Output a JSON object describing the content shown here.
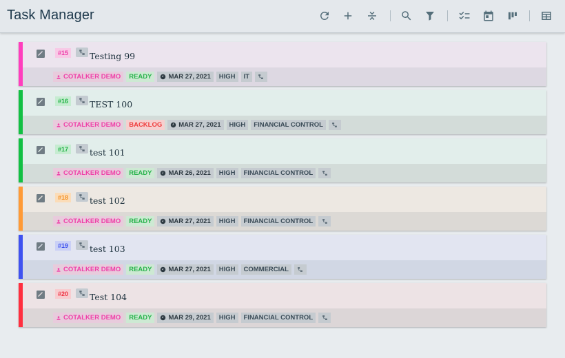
{
  "app": {
    "title": "Task Manager"
  },
  "toolbar": {
    "buttons": [
      {
        "name": "refresh-icon"
      },
      {
        "name": "add-icon"
      },
      {
        "name": "collapse-icon"
      },
      {
        "name": "search-icon"
      },
      {
        "name": "filter-icon"
      },
      {
        "name": "checklist-icon"
      },
      {
        "name": "calendar-icon"
      },
      {
        "name": "board-icon"
      },
      {
        "name": "table-icon"
      }
    ]
  },
  "tasks": [
    {
      "number": "#15",
      "title": "Testing 99",
      "user": "COTALKER DEMO",
      "status": "READY",
      "date": "MAR 27, 2021",
      "priority": "HIGH",
      "category": "IT",
      "accent": "#ff3ebd",
      "top_bg": "#ece4ee",
      "bottom_bg": "#ddd8e2",
      "num_bg": "#f8c9e6",
      "num_color": "#ee3aa8",
      "status_kind": "ready"
    },
    {
      "number": "#16",
      "title": "TEST 100",
      "user": "COTALKER DEMO",
      "status": "BACKLOG",
      "date": "MAR 27, 2021",
      "priority": "HIGH",
      "category": "FINANCIAL CONTROL",
      "accent": "#12c043",
      "top_bg": "#e2eeeb",
      "bottom_bg": "#d3dcd9",
      "num_bg": "#c6ecd1",
      "num_color": "#20b345",
      "status_kind": "backlog"
    },
    {
      "number": "#17",
      "title": "test 101",
      "user": "COTALKER DEMO",
      "status": "READY",
      "date": "MAR 26, 2021",
      "priority": "HIGH",
      "category": "FINANCIAL CONTROL",
      "accent": "#12c043",
      "top_bg": "#e2eeeb",
      "bottom_bg": "#d3dcd9",
      "num_bg": "#c6ecd1",
      "num_color": "#20b345",
      "status_kind": "ready"
    },
    {
      "number": "#18",
      "title": "test 102",
      "user": "COTALKER DEMO",
      "status": "READY",
      "date": "MAR 27, 2021",
      "priority": "HIGH",
      "category": "FINANCIAL CONTROL",
      "accent": "#ff9a36",
      "top_bg": "#ede8e2",
      "bottom_bg": "#dcd9d5",
      "num_bg": "#fbdcb8",
      "num_color": "#f59326",
      "status_kind": "ready"
    },
    {
      "number": "#19",
      "title": "test 103",
      "user": "COTALKER DEMO",
      "status": "READY",
      "date": "MAR 27, 2021",
      "priority": "HIGH",
      "category": "COMMERCIAL",
      "accent": "#3f52f0",
      "top_bg": "#e2e5f1",
      "bottom_bg": "#d1d7e4",
      "num_bg": "#cad0f6",
      "num_color": "#3e52ee",
      "status_kind": "ready"
    },
    {
      "number": "#20",
      "title": "Test 104",
      "user": "COTALKER DEMO",
      "status": "READY",
      "date": "MAR 29, 2021",
      "priority": "HIGH",
      "category": "FINANCIAL CONTROL",
      "accent": "#ff2f3f",
      "top_bg": "#ede3e5",
      "bottom_bg": "#dcd6d7",
      "num_bg": "#f8cccf",
      "num_color": "#ee3040",
      "status_kind": "ready"
    }
  ]
}
